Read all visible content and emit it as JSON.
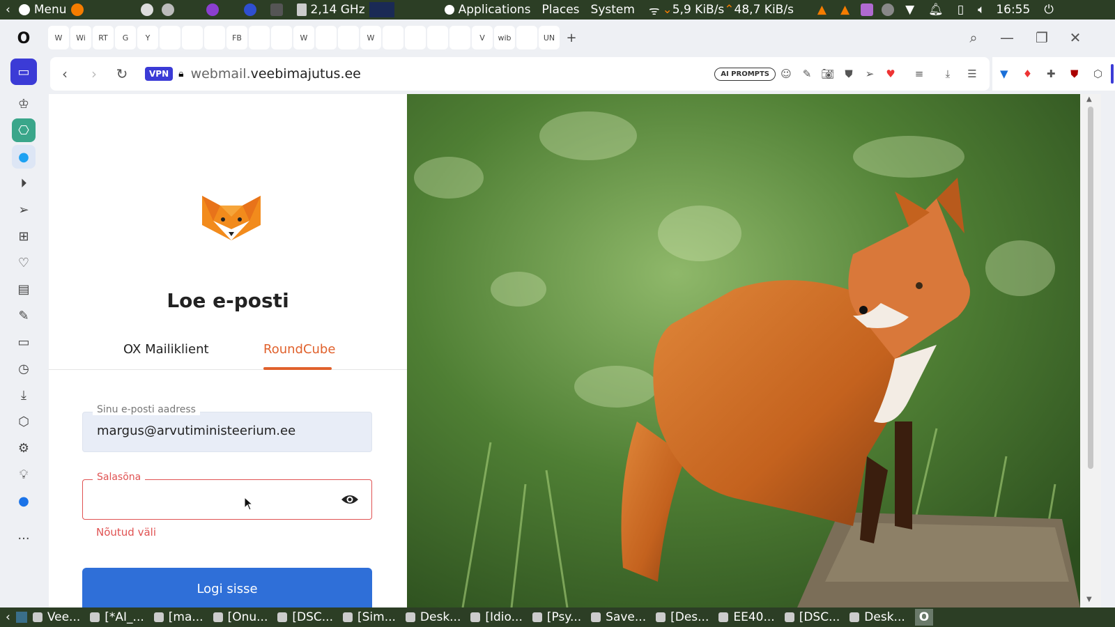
{
  "system_panel": {
    "menu_label": "Menu",
    "cpu_freq": "2,14 GHz",
    "applications_label": "Applications",
    "places_label": "Places",
    "system_label": "System",
    "net_down": "5,9 KiB/s",
    "net_up": "48,7 KiB/s",
    "clock": "16:55"
  },
  "browser": {
    "vpn_label": "VPN",
    "url_dim": "webmail.",
    "url_main": "veebimajutus.ee",
    "ai_prompts_label": "AI PROMPTS",
    "tabs": [
      "W",
      "Wi",
      "RT",
      "G",
      "Y",
      "",
      "",
      "",
      "FB",
      "",
      "",
      "W",
      "",
      "",
      "W",
      "",
      "",
      "",
      "",
      "V",
      "wib",
      "",
      "UN"
    ]
  },
  "page": {
    "title": "Loe e-posti",
    "tabs": [
      {
        "label": "OX Mailiklient",
        "active": false
      },
      {
        "label": "RoundCube",
        "active": true
      }
    ],
    "email_label": "Sinu e-posti aadress",
    "email_value": "margus@arvutiministeerium.ee",
    "password_label": "Salasõna",
    "password_error": "Nõutud väli",
    "submit_label": "Logi sisse",
    "accent_color": "#e0612c",
    "button_color": "#2f6fd8"
  },
  "taskbar": {
    "items": [
      "Vee...",
      "[*AI_...",
      "[ma...",
      "[Onu...",
      "[DSC...",
      "[Sim...",
      "Desk...",
      "[Idio...",
      "[Psy...",
      "Save...",
      "[Des...",
      "EE40...",
      "[DSC...",
      "Desk..."
    ]
  }
}
